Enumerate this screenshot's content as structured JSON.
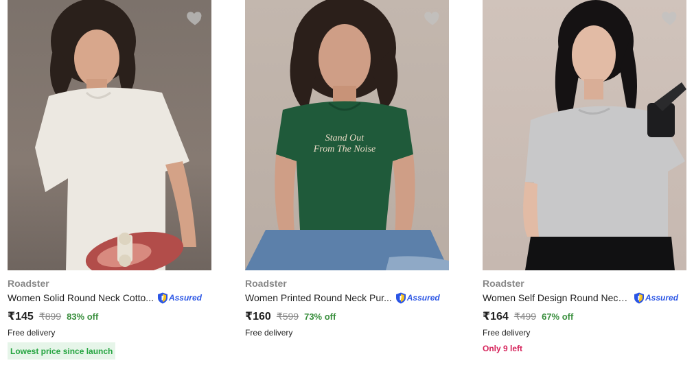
{
  "products": [
    {
      "brand": "Roadster",
      "title": "Women Solid Round Neck Cotto...",
      "assured_label": "Assured",
      "price": "₹145",
      "mrp": "₹899",
      "discount": "83% off",
      "delivery": "Free delivery",
      "highlight": "Lowest price since launch"
    },
    {
      "brand": "Roadster",
      "title": "Women Printed Round Neck Pur...",
      "assured_label": "Assured",
      "price": "₹160",
      "mrp": "₹599",
      "discount": "73% off",
      "delivery": "Free delivery",
      "print_text_line1": "Stand Out",
      "print_text_line2": "From The Noise"
    },
    {
      "brand": "Roadster",
      "title": "Women Self Design Round Neck...",
      "assured_label": "Assured",
      "price": "₹164",
      "mrp": "₹499",
      "discount": "67% off",
      "delivery": "Free delivery",
      "stock": "Only 9 left"
    }
  ],
  "colors": {
    "discount": "#388e3c",
    "assured": "#2a55e5",
    "stock_warning": "#d6225a",
    "highlight_bg": "#e6f5e9",
    "highlight_text": "#26a541"
  },
  "icons": {
    "wishlist": "heart-icon",
    "assured": "assured-shield-icon"
  }
}
